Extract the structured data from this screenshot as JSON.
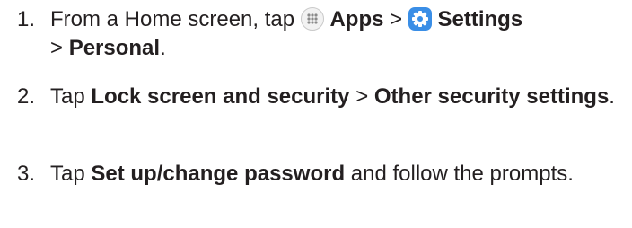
{
  "steps": [
    {
      "number": "1.",
      "text_a": "From a Home screen, tap",
      "apps_icon": "apps-grid-icon",
      "apps_label": "Apps",
      "sep1": ">",
      "settings_icon": "settings-gear-icon",
      "settings_label": "Settings",
      "sep2": ">",
      "personal_label": "Personal",
      "end": "."
    },
    {
      "number": "2.",
      "text_a": "Tap",
      "bold_1": "Lock screen and security",
      "sep": ">",
      "bold_2": "Other security settings",
      "end": "."
    },
    {
      "number": "3.",
      "text_a": "Tap",
      "bold_1": "Set up/change password",
      "text_b": "and follow the prompts."
    }
  ],
  "colors": {
    "text": "#231f20",
    "settings_icon_bg": "#3a8ee6",
    "apps_icon_bg": "#f2f2f2"
  }
}
